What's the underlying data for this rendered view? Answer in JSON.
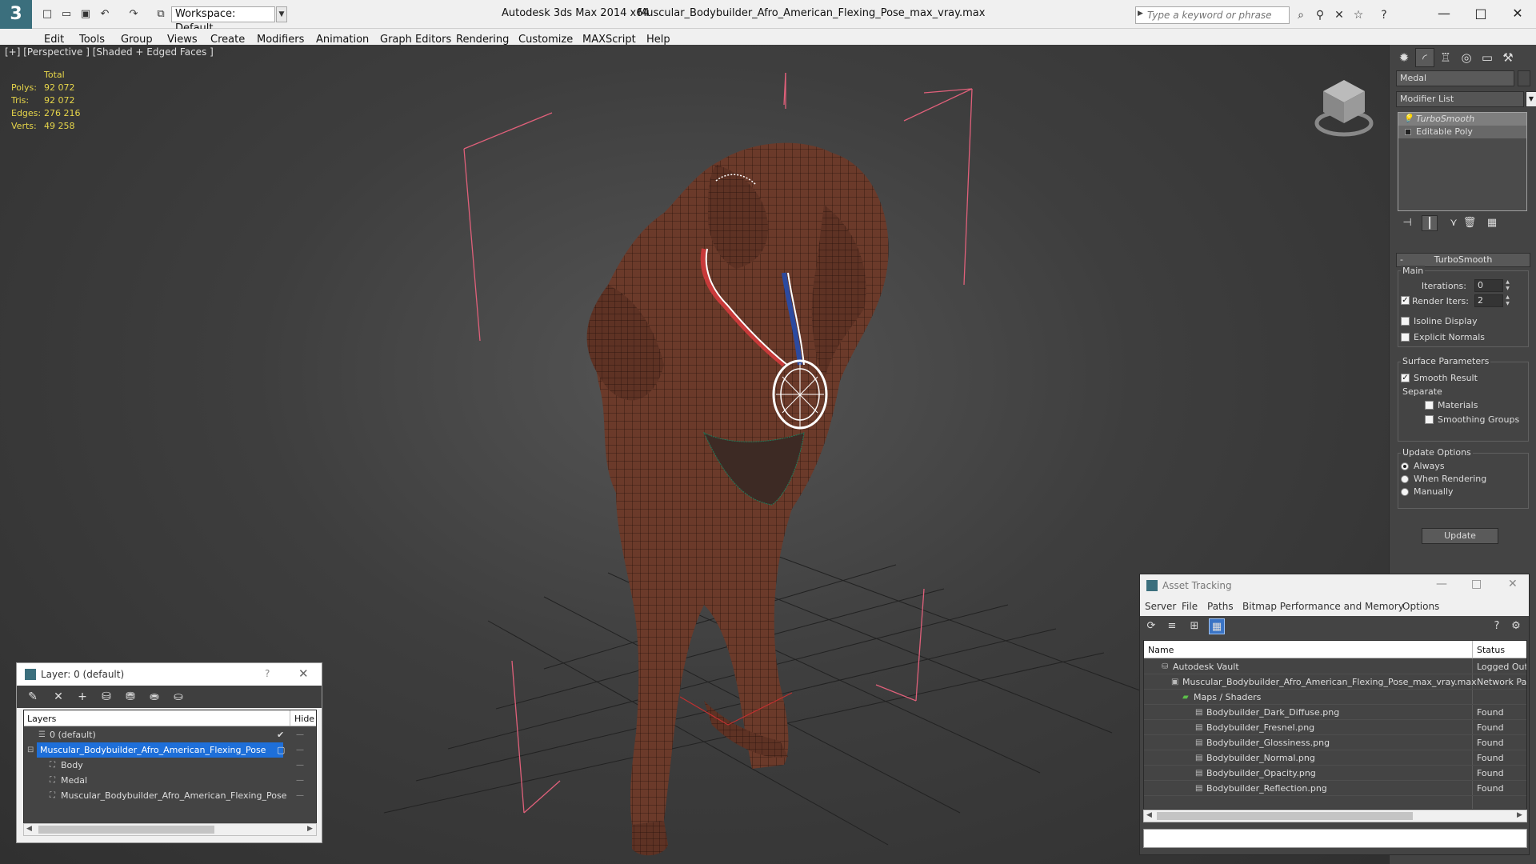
{
  "titlebar": {
    "app": "Autodesk 3ds Max  2014 x64",
    "file": "Muscular_Bodybuilder_Afro_American_Flexing_Pose_max_vray.max",
    "workspace": "Workspace: Default",
    "search_placeholder": "Type a keyword or phrase",
    "logo": "3"
  },
  "menu": [
    "Edit",
    "Tools",
    "Group",
    "Views",
    "Create",
    "Modifiers",
    "Animation",
    "Graph Editors",
    "Rendering",
    "Customize",
    "MAXScript",
    "Help"
  ],
  "viewport": {
    "label": "[+] [Perspective ] [Shaded + Edged Faces ]",
    "stats": {
      "header": "Total",
      "rows": [
        {
          "label": "Polys:",
          "value": "92 072"
        },
        {
          "label": "Tris:",
          "value": "92 072"
        },
        {
          "label": "Edges:",
          "value": "276 216"
        },
        {
          "label": "Verts:",
          "value": "49 258"
        }
      ]
    }
  },
  "command_panel": {
    "object_name": "Medal",
    "modifier_list": "Modifier List",
    "stack": [
      "TurboSmooth",
      "Editable Poly"
    ],
    "rollout_title": "TurboSmooth",
    "main_label": "Main",
    "iterations_label": "Iterations:",
    "iterations_value": "0",
    "render_iters_label": "Render Iters:",
    "render_iters_value": "2",
    "isoline_label": "Isoline Display",
    "explicit_normals_label": "Explicit Normals",
    "surface_params_label": "Surface Parameters",
    "smooth_result_label": "Smooth Result",
    "separate_label": "Separate",
    "materials_label": "Materials",
    "smoothing_groups_label": "Smoothing Groups",
    "update_options_label": "Update Options",
    "always_label": "Always",
    "when_rendering_label": "When Rendering",
    "manually_label": "Manually",
    "update_button": "Update"
  },
  "layer_dialog": {
    "title": "Layer: 0 (default)",
    "help": "?",
    "col_layers": "Layers",
    "col_hide": "Hide",
    "rows": [
      {
        "name": "0 (default)"
      },
      {
        "name": "Muscular_Bodybuilder_Afro_American_Flexing_Pose"
      },
      {
        "name": "Body"
      },
      {
        "name": "Medal"
      },
      {
        "name": "Muscular_Bodybuilder_Afro_American_Flexing_Pose"
      }
    ]
  },
  "asset_dialog": {
    "title": "Asset Tracking",
    "menu": [
      "Server",
      "File",
      "Paths",
      "Bitmap Performance and Memory",
      "Options"
    ],
    "col_name": "Name",
    "col_status": "Status",
    "rows": [
      {
        "name": "Autodesk Vault",
        "status": "Logged Out"
      },
      {
        "name": "Muscular_Bodybuilder_Afro_American_Flexing_Pose_max_vray.max",
        "status": "Network Pa"
      },
      {
        "name": "Maps / Shaders",
        "status": ""
      },
      {
        "name": "Bodybuilder_Dark_Diffuse.png",
        "status": "Found"
      },
      {
        "name": "Bodybuilder_Fresnel.png",
        "status": "Found"
      },
      {
        "name": "Bodybuilder_Glossiness.png",
        "status": "Found"
      },
      {
        "name": "Bodybuilder_Normal.png",
        "status": "Found"
      },
      {
        "name": "Bodybuilder_Opacity.png",
        "status": "Found"
      },
      {
        "name": "Bodybuilder_Reflection.png",
        "status": "Found"
      }
    ]
  },
  "colors": {
    "stats_text": "#e7d64a",
    "selection": "#1e6fd9",
    "bounding_box": "#e0607a",
    "mesh_skin": "#6b3a2a"
  }
}
